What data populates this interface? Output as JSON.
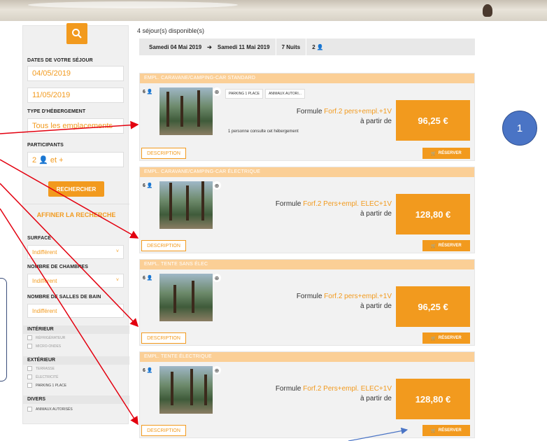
{
  "sidebar": {
    "dates_label": "DATES DE VOTRE SÉJOUR",
    "date_from": "04/05/2019",
    "date_to": "11/05/2019",
    "type_label": "TYPE D'HÉBERGEMENT",
    "type_value": "Tous les emplacements",
    "participants_label": "PARTICIPANTS",
    "participants_value": "2 👤 et +",
    "search_button": "RECHERCHER",
    "refine_title": "AFFINER LA RECHERCHE",
    "surface_label": "SURFACE",
    "surface_value": "Indifférent",
    "rooms_label": "NOMBRE DE CHAMBRES",
    "rooms_value": "Indifférent",
    "bathrooms_label": "NOMBRE DE SALLES DE BAIN",
    "bathrooms_value": "Indifférent",
    "interieur_label": "INTÉRIEUR",
    "interieur_options": [
      "RÉFRIGÉRATEUR",
      "MICRO-ONDES"
    ],
    "exterieur_label": "EXTÉRIEUR",
    "exterieur_options": [
      "TERRASSE",
      "ÉLECTRICITÉ",
      "PARKING 1 PLACE"
    ],
    "divers_label": "DIVERS",
    "divers_options": [
      "ANIMAUX AUTORISÉS"
    ]
  },
  "results": {
    "count_text": "4 séjour(s) disponible(s)",
    "from_date": "Samedi 04 Mai 2019",
    "arrow": "➔",
    "to_date": "Samedi 11 Mai 2019",
    "nights": "7 Nuits",
    "people": "2 👤"
  },
  "cards": [
    {
      "title": "EMPL. CARAVANE/CAMPING-CAR STANDARD",
      "capacity": "6 👤",
      "tags": [
        "PARKING 1 PLACE",
        "ANIMAUX AUTORI..."
      ],
      "formule_prefix": "Formule ",
      "formule_name": "Forf.2 pers+empl.+1V",
      "from_text": "à partir de",
      "price": "96,25 €",
      "consult": "1 personne consulte cet hébergement",
      "description": "DESCRIPTION",
      "reserve": "RÉSERVER"
    },
    {
      "title": "EMPL. CARAVANE/CAMPING-CAR ÉLECTRIQUE",
      "capacity": "6 👤",
      "formule_prefix": "Formule ",
      "formule_name": "Forf.2 Pers+empl. ELEC+1V",
      "from_text": "à partir de",
      "price": "128,80 €",
      "description": "DESCRIPTION",
      "reserve": "RÉSERVER"
    },
    {
      "title": "EMPL. TENTE SANS ÉLEC",
      "capacity": "6 👤",
      "formule_prefix": "Formule ",
      "formule_name": "Forf.2 pers+empl.+1V",
      "from_text": "à partir de",
      "price": "96,25 €",
      "description": "DESCRIPTION",
      "reserve": "RÉSERVER"
    },
    {
      "title": "EMPL. TENTE ÉLECTRIQUE",
      "capacity": "6 👤",
      "formule_prefix": "Formule ",
      "formule_name": "Forf.2 Pers+empl. ELEC+1V",
      "from_text": "à partir de",
      "price": "128,80 €",
      "description": "DESCRIPTION",
      "reserve": "RÉSERVER"
    }
  ],
  "annotation": {
    "badge": "1"
  },
  "colors": {
    "accent": "#f29a1e",
    "card_header": "#fbcf96",
    "annotation_arrow": "#e3000f",
    "badge": "#4a74c5"
  }
}
